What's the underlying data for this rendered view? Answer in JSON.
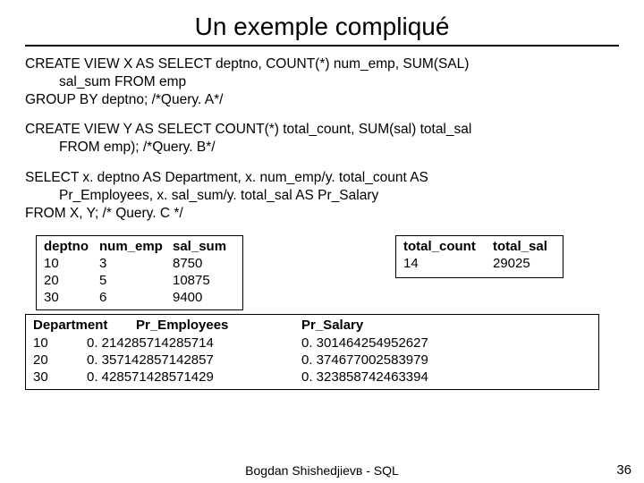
{
  "title": "Un exemple compliqué",
  "blocks": {
    "q1_l1": "CREATE VIEW X AS SELECT deptno, COUNT(*) num_emp, SUM(SAL)",
    "q1_l2": "sal_sum FROM emp",
    "q1_l3": "GROUP BY deptno; /*Query. A*/",
    "q2_l1": "CREATE VIEW  Y AS SELECT COUNT(*) total_count, SUM(sal) total_sal",
    "q2_l2": "FROM emp); /*Query. B*/",
    "q3_l1": "SELECT x. deptno AS Department, x. num_emp/y. total_count AS",
    "q3_l2": "Pr_Employees, x. sal_sum/y. total_sal AS Pr_Salary",
    "q3_l3": "FROM X, Y; /* Query. C */"
  },
  "table_a": {
    "h1": "deptno",
    "h2": "num_emp",
    "h3": "sal_sum",
    "rows": [
      {
        "c1": "10",
        "c2": "3",
        "c3": "8750"
      },
      {
        "c1": "20",
        "c2": "5",
        "c3": "10875"
      },
      {
        "c1": "30",
        "c2": "6",
        "c3": "9400"
      }
    ]
  },
  "table_b": {
    "h1": "total_count",
    "h2": "total_sal",
    "rows": [
      {
        "c1": "14",
        "c2": "29025"
      }
    ]
  },
  "table_c": {
    "h1": "Department",
    "h2": "Pr_Employees",
    "h3": "Pr_Salary",
    "rows": [
      {
        "c1": "10",
        "c2": "0. 214285714285714",
        "c3": "0. 301464254952627"
      },
      {
        "c1": "20",
        "c2": "0. 357142857142857",
        "c3": "0. 374677002583979"
      },
      {
        "c1": "30",
        "c2": "0. 428571428571429",
        "c3": "0. 323858742463394"
      }
    ]
  },
  "footer": "Bogdan Shishedjievв - SQL",
  "page": "36"
}
